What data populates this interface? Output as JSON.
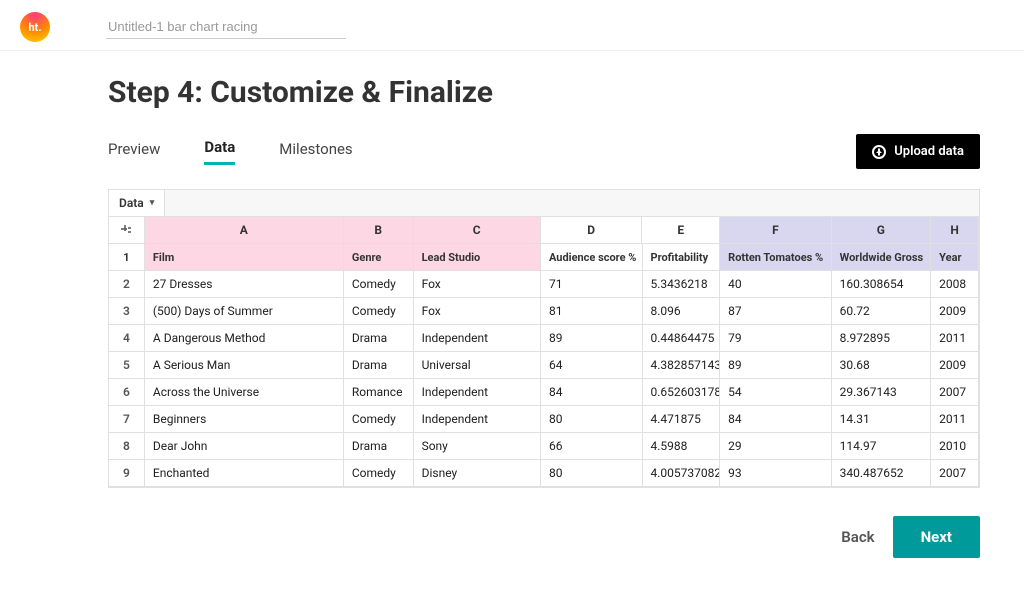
{
  "header": {
    "logo_text": "ht.",
    "title_input": "Untitled-1 bar chart racing"
  },
  "page": {
    "title": "Step 4: Customize & Finalize"
  },
  "tabs": {
    "preview": "Preview",
    "data": "Data",
    "milestones": "Milestones",
    "active": "data"
  },
  "upload": {
    "label": "Upload data"
  },
  "sheet": {
    "tab_label": "Data",
    "columns": [
      "A",
      "B",
      "C",
      "D",
      "E",
      "F",
      "G",
      "H"
    ],
    "col_classes": [
      "col-A",
      "col-B",
      "col-C",
      "col-D",
      "col-E",
      "col-F",
      "col-G",
      "col-H"
    ],
    "col_colors": [
      "pink",
      "pink",
      "pink",
      "",
      "",
      "purple",
      "purple",
      "purple"
    ],
    "header_row": [
      "Film",
      "Genre",
      "Lead Studio",
      "Audience score %",
      "Profitability",
      "Rotten Tomatoes %",
      "Worldwide Gross",
      "Year"
    ],
    "rows": [
      [
        "27 Dresses",
        "Comedy",
        "Fox",
        "71",
        "5.3436218",
        "40",
        "160.308654",
        "2008"
      ],
      [
        "(500) Days of Summer",
        "Comedy",
        "Fox",
        "81",
        "8.096",
        "87",
        "60.72",
        "2009"
      ],
      [
        "A Dangerous Method",
        "Drama",
        "Independent",
        "89",
        "0.44864475",
        "79",
        "8.972895",
        "2011"
      ],
      [
        "A Serious Man",
        "Drama",
        "Universal",
        "64",
        "4.382857143",
        "89",
        "30.68",
        "2009"
      ],
      [
        "Across the Universe",
        "Romance",
        "Independent",
        "84",
        "0.652603178",
        "54",
        "29.367143",
        "2007"
      ],
      [
        "Beginners",
        "Comedy",
        "Independent",
        "80",
        "4.471875",
        "84",
        "14.31",
        "2011"
      ],
      [
        "Dear John",
        "Drama",
        "Sony",
        "66",
        "4.5988",
        "29",
        "114.97",
        "2010"
      ],
      [
        "Enchanted",
        "Comedy",
        "Disney",
        "80",
        "4.005737082",
        "93",
        "340.487652",
        "2007"
      ]
    ]
  },
  "footer": {
    "back": "Back",
    "next": "Next"
  }
}
